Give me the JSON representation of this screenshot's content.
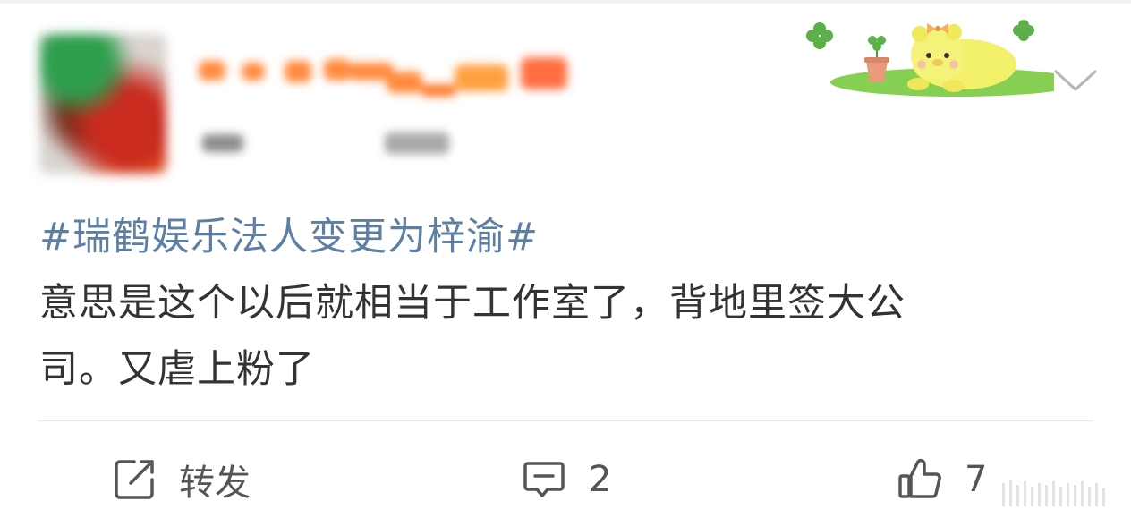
{
  "post": {
    "hashtag": "#瑞鹤娱乐法人变更为梓渝#",
    "text_line1": "意思是这个以后就相当于工作室了，背地里签大公",
    "text_line2": "司。又虐上粉了"
  },
  "actions": {
    "repost_label": "转发",
    "comment_count": "2",
    "like_count": "7"
  },
  "icons": {
    "repost": "share-edit-icon",
    "comment": "comment-bubble-icon",
    "like": "thumbs-up-icon",
    "more": "chevron-down-icon"
  },
  "colors": {
    "hashtag": "#5d7fa3",
    "text": "#333333",
    "icon": "#555555"
  }
}
